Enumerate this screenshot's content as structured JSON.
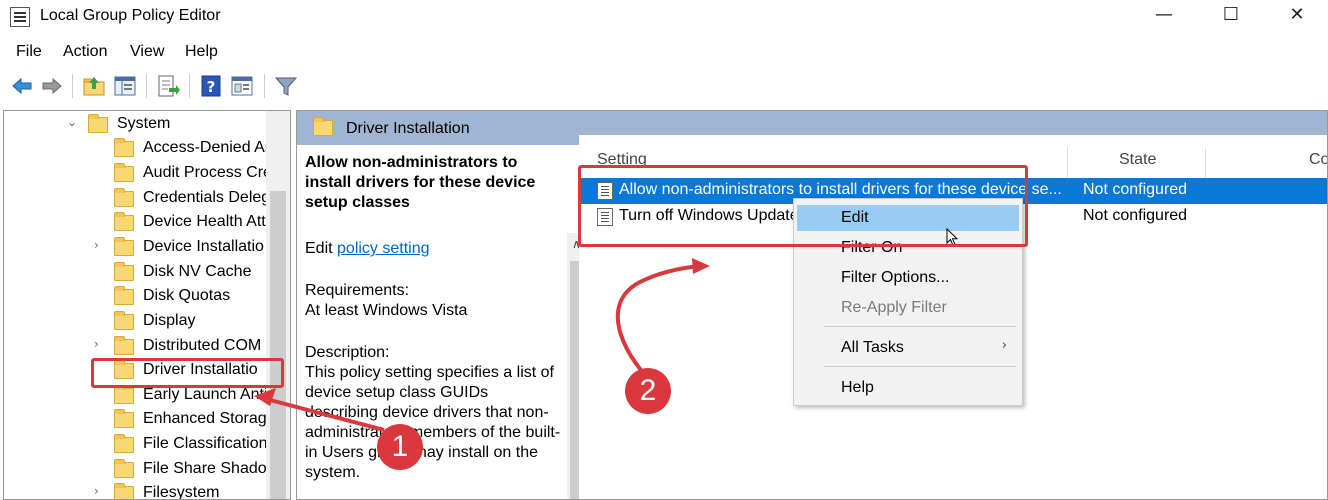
{
  "window": {
    "title": "Local Group Policy Editor",
    "controls": {
      "minimize": "—",
      "maximize": "☐",
      "close": "✕"
    }
  },
  "menu": [
    "File",
    "Action",
    "View",
    "Help"
  ],
  "toolbar": [
    "back-icon",
    "forward-icon",
    "up-folder-icon",
    "show-hide-tree-icon",
    "export-list-icon",
    "help-icon",
    "properties-icon",
    "filter-icon"
  ],
  "tree": {
    "items": [
      {
        "label": "System",
        "level": 0,
        "expander": "⌄"
      },
      {
        "label": "Access-Denied As",
        "level": 1,
        "expander": ""
      },
      {
        "label": "Audit Process Cre",
        "level": 1,
        "expander": ""
      },
      {
        "label": "Credentials Deleg",
        "level": 1,
        "expander": ""
      },
      {
        "label": "Device Health Att",
        "level": 1,
        "expander": ""
      },
      {
        "label": "Device Installatio",
        "level": 1,
        "expander": "›"
      },
      {
        "label": "Disk NV Cache",
        "level": 1,
        "expander": ""
      },
      {
        "label": "Disk Quotas",
        "level": 1,
        "expander": ""
      },
      {
        "label": "Display",
        "level": 1,
        "expander": ""
      },
      {
        "label": "Distributed COM",
        "level": 1,
        "expander": "›"
      },
      {
        "label": "Driver Installatio",
        "level": 1,
        "expander": ""
      },
      {
        "label": "Early Launch Anti",
        "level": 1,
        "expander": ""
      },
      {
        "label": "Enhanced Storag",
        "level": 1,
        "expander": ""
      },
      {
        "label": "File Classification",
        "level": 1,
        "expander": ""
      },
      {
        "label": "File Share Shadov",
        "level": 1,
        "expander": ""
      },
      {
        "label": "Filesystem",
        "level": 1,
        "expander": "›"
      }
    ]
  },
  "pane": {
    "header": "Driver Installation",
    "description": {
      "title": "Allow non-administrators to install drivers for these device setup classes",
      "edit_prefix": "Edit ",
      "edit_link": "policy setting ",
      "requirements_label": "Requirements:",
      "requirements_value": "At least Windows Vista",
      "description_label": "Description:",
      "description_text": "This policy setting specifies a list of device setup class GUIDs describing device drivers that non-administrators members of the built-in Users group may install on the system."
    },
    "scroll_arrow": "∧",
    "columns": {
      "setting": "Setting",
      "state": "State",
      "comment": "Co"
    },
    "rows": [
      {
        "setting": "Allow non-administrators to install drivers for these device se...",
        "state": "Not configured",
        "selected": true
      },
      {
        "setting": "Turn off Windows Update device driver search prompt",
        "state": "Not configured",
        "selected": false
      }
    ]
  },
  "context_menu": {
    "items": [
      {
        "label": "Edit",
        "hover": true,
        "disabled": false,
        "submenu": ""
      },
      {
        "label": "Filter On",
        "hover": false,
        "disabled": false,
        "submenu": ""
      },
      {
        "label": "Filter Options...",
        "hover": false,
        "disabled": false,
        "submenu": ""
      },
      {
        "label": "Re-Apply Filter",
        "hover": false,
        "disabled": true,
        "submenu": ""
      },
      {
        "label": "All Tasks",
        "hover": false,
        "disabled": false,
        "submenu": "›"
      },
      {
        "label": "Help",
        "hover": false,
        "disabled": false,
        "submenu": ""
      }
    ]
  },
  "annotations": {
    "badge_1": "1",
    "badge_2": "2"
  },
  "colors": {
    "highlight_red": "#d9393d",
    "selection_blue": "#0a78d7",
    "hover_blue": "#99ccf3",
    "header_blue": "#9fb5d1"
  }
}
